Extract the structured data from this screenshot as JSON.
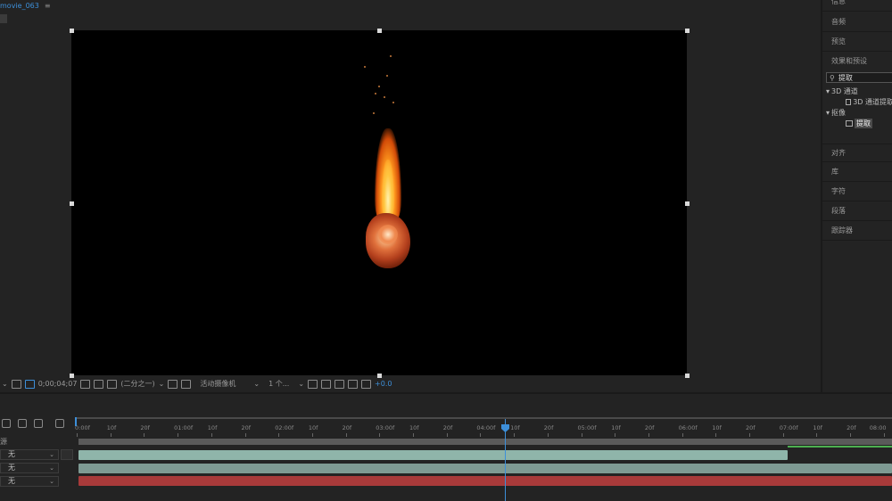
{
  "composition": {
    "tab_name": "movie_063",
    "tab_menu_glyph": "≡"
  },
  "viewer_toolbar": {
    "timecode": "0;00;04;07",
    "resolution": "(二分之一)",
    "camera": "活动摄像机",
    "views": "1 个...",
    "exposure": "+0.0",
    "dropdown_glyph": "⌄"
  },
  "right_panel": {
    "info": "信息",
    "audio": "音频",
    "preview": "预览",
    "effects_presets": "效果和预设",
    "search_value": "提取",
    "search_icon": "search-icon",
    "tree": {
      "cat_3d": "3D 通道",
      "fx_3d": "3D 通道提取",
      "cat_keying": "抠像",
      "fx_extract": "提取"
    },
    "align": "对齐",
    "library": "库",
    "character": "字符",
    "paragraph": "段落",
    "tracker": "跟踪器"
  },
  "timeline": {
    "header_label": "源",
    "modes": [
      "无",
      "无",
      "无"
    ],
    "ruler_labels": [
      "0:00f",
      "10f",
      "20f",
      "01:00f",
      "10f",
      "20f",
      "02:00f",
      "10f",
      "20f",
      "03:00f",
      "10f",
      "20f",
      "04:00f",
      "10f",
      "20f",
      "05:00f",
      "10f",
      "20f",
      "06:00f",
      "10f",
      "20f",
      "07:00f",
      "10f",
      "20f",
      "08:00"
    ],
    "track_colors": [
      "#8fb5aa",
      "#7e9a93",
      "#a83a3a"
    ]
  }
}
